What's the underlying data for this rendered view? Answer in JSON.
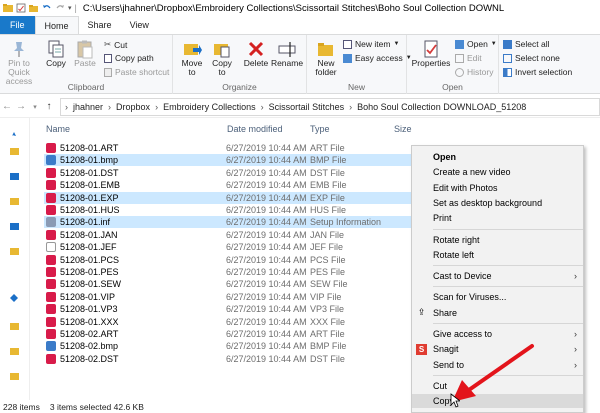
{
  "window": {
    "title": "C:\\Users\\jhahner\\Dropbox\\Embroidery Collections\\Scissortail Stitches\\Boho Soul Collection DOWNL"
  },
  "tabs": [
    {
      "label": "File"
    },
    {
      "label": "Home"
    },
    {
      "label": "Share"
    },
    {
      "label": "View"
    }
  ],
  "ribbon": {
    "clipboard": {
      "pin_label": "Pin to Quick access",
      "copy_label": "Copy",
      "paste_label": "Paste",
      "cut_label": "Cut",
      "copy_path_label": "Copy path",
      "paste_shortcut_label": "Paste shortcut",
      "group_label": "Clipboard"
    },
    "organize": {
      "move_to_label": "Move to",
      "copy_to_label": "Copy to",
      "delete_label": "Delete",
      "rename_label": "Rename",
      "group_label": "Organize"
    },
    "new": {
      "new_folder_label": "New folder",
      "new_item_label": "New item",
      "easy_access_label": "Easy access",
      "group_label": "New"
    },
    "open": {
      "properties_label": "Properties",
      "open_label": "Open",
      "edit_label": "Edit",
      "history_label": "History",
      "group_label": "Open"
    },
    "select": {
      "select_all_label": "Select all",
      "select_none_label": "Select none",
      "invert_label": "Invert selection"
    }
  },
  "address": {
    "crumbs": [
      "jhahner",
      "Dropbox",
      "Embroidery Collections",
      "Scissortail Stitches",
      "Boho Soul Collection DOWNLOAD_51208"
    ]
  },
  "columns": {
    "name": "Name",
    "date": "Date modified",
    "type": "Type",
    "size": "Size"
  },
  "files": [
    {
      "name": "51208-01.ART",
      "date": "6/27/2019 10:44 AM",
      "type": "ART File",
      "selected": false,
      "icon": "embroidery-file-icon"
    },
    {
      "name": "51208-01.bmp",
      "date": "6/27/2019 10:44 AM",
      "type": "BMP File",
      "selected": true,
      "icon": "bitmap-file-icon"
    },
    {
      "name": "51208-01.DST",
      "date": "6/27/2019 10:44 AM",
      "type": "DST File",
      "selected": false,
      "icon": "embroidery-file-icon"
    },
    {
      "name": "51208-01.EMB",
      "date": "6/27/2019 10:44 AM",
      "type": "EMB File",
      "selected": false,
      "icon": "embroidery-file-icon"
    },
    {
      "name": "51208-01.EXP",
      "date": "6/27/2019 10:44 AM",
      "type": "EXP File",
      "selected": true,
      "icon": "embroidery-file-icon"
    },
    {
      "name": "51208-01.HUS",
      "date": "6/27/2019 10:44 AM",
      "type": "HUS File",
      "selected": false,
      "icon": "embroidery-file-icon"
    },
    {
      "name": "51208-01.inf",
      "date": "6/27/2019 10:44 AM",
      "type": "Setup Information",
      "selected": true,
      "icon": "setup-file-icon"
    },
    {
      "name": "51208-01.JAN",
      "date": "6/27/2019 10:44 AM",
      "type": "JAN File",
      "selected": false,
      "icon": "embroidery-file-icon"
    },
    {
      "name": "51208-01.JEF",
      "date": "6/27/2019 10:44 AM",
      "type": "JEF File",
      "selected": false,
      "icon": "blank-file-icon"
    },
    {
      "name": "51208-01.PCS",
      "date": "6/27/2019 10:44 AM",
      "type": "PCS File",
      "selected": false,
      "icon": "embroidery-file-icon"
    },
    {
      "name": "51208-01.PES",
      "date": "6/27/2019 10:44 AM",
      "type": "PES File",
      "selected": false,
      "icon": "embroidery-file-icon"
    },
    {
      "name": "51208-01.SEW",
      "date": "6/27/2019 10:44 AM",
      "type": "SEW File",
      "selected": false,
      "icon": "embroidery-file-icon"
    },
    {
      "name": "51208-01.VIP",
      "date": "6/27/2019 10:44 AM",
      "type": "VIP File",
      "selected": false,
      "icon": "embroidery-file-icon"
    },
    {
      "name": "51208-01.VP3",
      "date": "6/27/2019 10:44 AM",
      "type": "VP3 File",
      "selected": false,
      "icon": "embroidery-file-icon"
    },
    {
      "name": "51208-01.XXX",
      "date": "6/27/2019 10:44 AM",
      "type": "XXX File",
      "selected": false,
      "icon": "embroidery-file-icon"
    },
    {
      "name": "51208-02.ART",
      "date": "6/27/2019 10:44 AM",
      "type": "ART File",
      "selected": false,
      "icon": "embroidery-file-icon"
    },
    {
      "name": "51208-02.bmp",
      "date": "6/27/2019 10:44 AM",
      "type": "BMP File",
      "selected": false,
      "icon": "bitmap-file-icon"
    },
    {
      "name": "51208-02.DST",
      "date": "6/27/2019 10:44 AM",
      "type": "DST File",
      "selected": false,
      "icon": "embroidery-file-icon"
    }
  ],
  "context_menu": {
    "items": [
      {
        "label": "Open",
        "bold": true
      },
      {
        "label": "Create a new video"
      },
      {
        "label": "Edit with Photos"
      },
      {
        "label": "Set as desktop background"
      },
      {
        "label": "Print"
      },
      {
        "label": "Rotate right"
      },
      {
        "label": "Rotate left"
      },
      {
        "label": "Cast to Device",
        "submenu": true
      },
      {
        "label": "Scan for Viruses..."
      },
      {
        "label": "Share",
        "icon": "share-icon"
      },
      {
        "label": "Give access to",
        "submenu": true
      },
      {
        "label": "Snagit",
        "submenu": true,
        "icon": "snagit-icon"
      },
      {
        "label": "Send to",
        "submenu": true
      },
      {
        "label": "Cut"
      },
      {
        "label": "Copy",
        "highlighted": true
      }
    ]
  },
  "status": {
    "count": "228 items",
    "selection": "3 items selected  42.6 KB"
  },
  "colors": {
    "accent": "#1979ca",
    "selection": "#cce8ff",
    "annotation_arrow": "#e3141b"
  }
}
